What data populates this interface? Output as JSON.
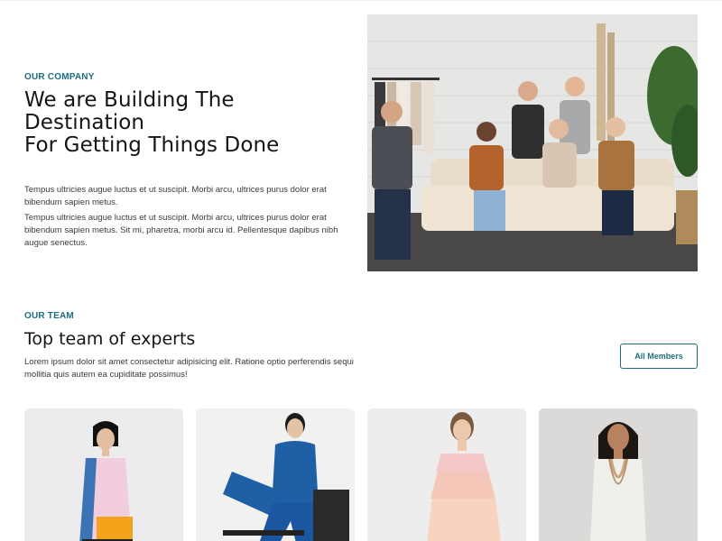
{
  "company": {
    "eyebrow": "OUR COMPANY",
    "headline_line1": "We are Building The Destination",
    "headline_line2": "For Getting Things Done",
    "paragraph1": "Tempus ultricies augue luctus et ut suscipit. Morbi arcu, ultrices purus dolor erat bibendum sapien metus.",
    "paragraph2": "Tempus ultricies augue luctus et ut suscipit. Morbi arcu, ultrices purus dolor erat bibendum sapien metus. Sit mi, pharetra, morbi arcu id. Pellentesque dapibus nibh augue senectus."
  },
  "team": {
    "eyebrow": "OUR TEAM",
    "title": "Top team of experts",
    "description": "Lorem ipsum dolor sit amet consectetur adipisicing elit. Ratione optio perferendis sequi mollitia quis autem ea cupiditate possimus!",
    "button_label": "All Members"
  },
  "colors": {
    "accent": "#1c6f80",
    "heading": "#151515",
    "body_text": "#3a3a3a"
  },
  "images": {
    "hero": "group-photo-team",
    "members": [
      "member-photo-colorblock-dress",
      "member-photo-blue-suit",
      "member-photo-pink-ruffle-top",
      "member-photo-white-dress-necklace"
    ]
  }
}
